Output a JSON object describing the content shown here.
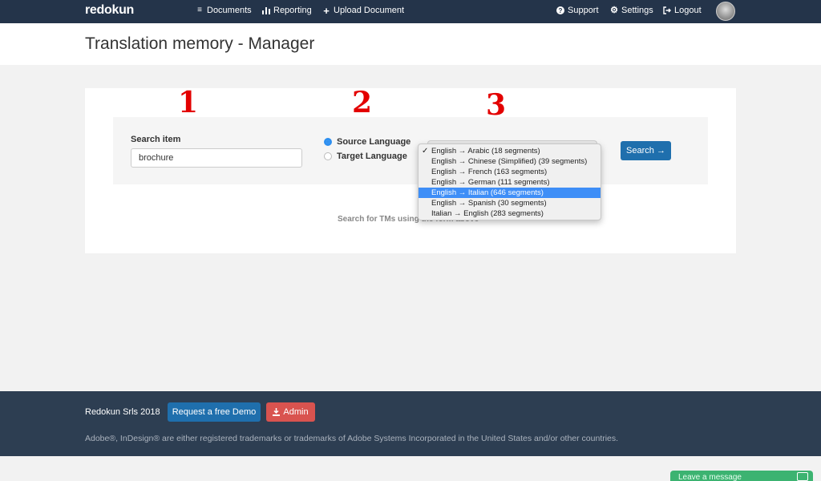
{
  "navbar": {
    "brand": "redokun",
    "links": {
      "documents": "Documents",
      "reporting": "Reporting",
      "upload": "Upload Document",
      "support": "Support",
      "settings": "Settings",
      "logout": "Logout"
    },
    "icons": {
      "documents": "documents-icon",
      "reporting": "bar-chart-icon",
      "upload": "plus-icon",
      "support": "question-circle-icon",
      "settings": "gear-icon",
      "logout": "logout-icon"
    },
    "background": "#24344a"
  },
  "page": {
    "title": "Translation memory - Manager"
  },
  "annotations": [
    "1",
    "2",
    "3"
  ],
  "search": {
    "label": "Search item",
    "value": "brochure",
    "source_language_label": "Source Language",
    "target_language_label": "Target Language",
    "selected_mode": "source",
    "button_label": "Search →",
    "help_text": "Search for TMs using the form above"
  },
  "language_pair_select": {
    "options": [
      "English → Arabic (18 segments)",
      "English → Chinese (Simplified) (39 segments)",
      "English → French (163 segments)",
      "English → German (111 segments)",
      "English → Italian (646 segments)",
      "English → Spanish (30 segments)",
      "Italian → English (283 segments)"
    ],
    "checked_index": 0,
    "highlighted_index": 4,
    "check_mark": "✓"
  },
  "footer": {
    "copyright": "Redokun Srls 2018",
    "demo_button": "Request a free Demo",
    "admin_button": "Admin",
    "trademark_note": "Adobe®, InDesign® are either registered trademarks or trademarks of Adobe Systems Incorporated in the United States and/or other countries."
  },
  "chat_widget": {
    "label": "Leave a message"
  },
  "colors": {
    "primary_button": "#1f6fad",
    "danger_button": "#d9534f",
    "highlight": "#3e8ef7",
    "annotation": "#e30000",
    "chat": "#3cb371"
  }
}
